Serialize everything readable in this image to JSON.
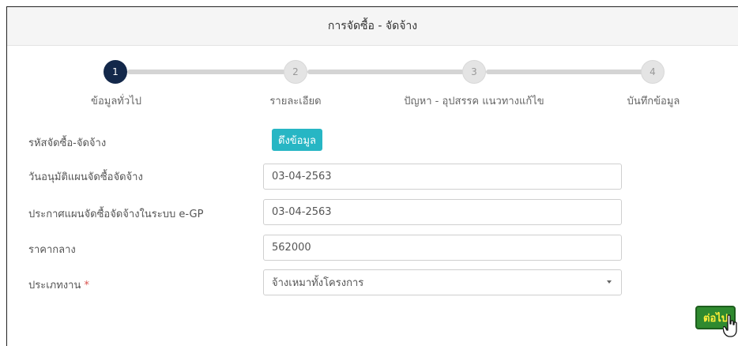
{
  "header": {
    "title": "การจัดซื้อ - จัดจ้าง"
  },
  "steps": [
    {
      "number": "1",
      "label": "ข้อมูลทั่วไป",
      "active": true
    },
    {
      "number": "2",
      "label": "รายละเอียด",
      "active": false
    },
    {
      "number": "3",
      "label": "ปัญหา - อุปสรรค แนวทางแก้ไข",
      "active": false
    },
    {
      "number": "4",
      "label": "บันทึกข้อมูล",
      "active": false
    }
  ],
  "form": {
    "procurement_code": {
      "label": "รหัสจัดซื้อ-จัดจ้าง",
      "button": "ดึงข้อมูล"
    },
    "approval_date": {
      "label": "วันอนุมัติแผนจัดซื้อจัดจ้าง",
      "value": "03-04-2563"
    },
    "egp_date": {
      "label": "ประกาศแผนจัดซื้อจัดจ้างในระบบ e-GP",
      "value": "03-04-2563"
    },
    "median_price": {
      "label": "ราคากลาง",
      "value": "562000"
    },
    "work_type": {
      "label": "ประเภทงาน",
      "required_mark": "*",
      "value": "จ้างเหมาทั้งโครงการ"
    }
  },
  "actions": {
    "next_label": "ต่อไป"
  },
  "colors": {
    "active_step": "#13284a",
    "fetch_button": "#27b6c4",
    "next_button": "#2f8a2f",
    "next_text": "#ffef3a"
  },
  "icons": {
    "cursor": "hand-pointer-icon",
    "select_caret": "caret-down-icon"
  }
}
